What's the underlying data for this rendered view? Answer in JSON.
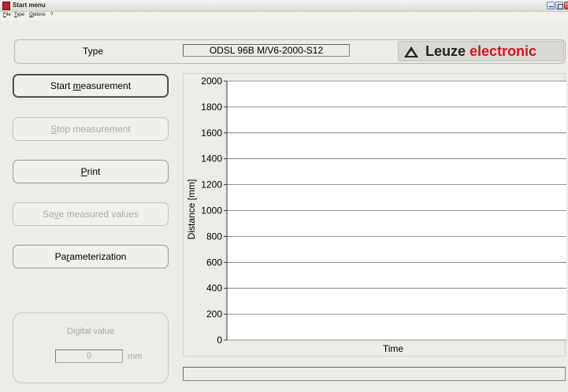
{
  "window": {
    "title": "Start menu"
  },
  "menu": [
    {
      "label": "File",
      "ul": "F",
      "rest": "ile"
    },
    {
      "label": "Type",
      "ul": "T",
      "rest": "ype"
    },
    {
      "label": "Options",
      "ul": "O",
      "rest": "ptions"
    },
    {
      "label": "?",
      "ul": "",
      "rest": "?"
    }
  ],
  "header": {
    "type_label": "Type",
    "type_value": "ODSL 96B M/V6-2000-S12",
    "logo_word1": "Leuze",
    "logo_word2": "electronic",
    "logo_color": "#d4141a"
  },
  "buttons": {
    "start": {
      "pre": "Start ",
      "ul": "m",
      "post": "easurement"
    },
    "stop": {
      "pre": "",
      "ul": "S",
      "post": "top measurement"
    },
    "print": {
      "pre": "",
      "ul": "P",
      "post": "rint"
    },
    "save": {
      "pre": "Sa",
      "ul": "v",
      "post": "e measured values"
    },
    "param": {
      "pre": "Pa",
      "ul": "r",
      "post": "ameterization"
    }
  },
  "digital": {
    "label": "Digital value",
    "value": "0",
    "unit": "mm"
  },
  "status": {
    "text": ""
  },
  "chart_data": {
    "type": "line",
    "title": "",
    "xlabel": "Time",
    "ylabel": "Distance [mm]",
    "ylim": [
      0,
      2000
    ],
    "yticks": [
      0,
      200,
      400,
      600,
      800,
      1000,
      1200,
      1400,
      1600,
      1800,
      2000
    ],
    "grid": true,
    "series": []
  }
}
